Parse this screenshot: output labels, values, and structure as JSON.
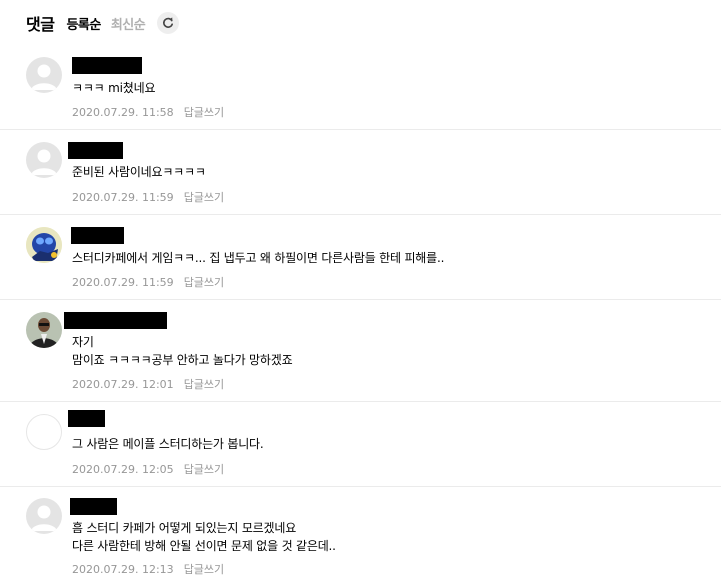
{
  "header": {
    "title": "댓글",
    "sort_registered": "등록순",
    "sort_latest": "최신순",
    "refresh_icon": "refresh-icon"
  },
  "comments": [
    {
      "avatar": "default-avatar",
      "lines": [
        "ㅋㅋㅋ mi쳤네요"
      ],
      "date": "2020.07.29. 11:58",
      "reply": "답글쓰기"
    },
    {
      "avatar": "default-avatar",
      "lines": [
        "준비된 사람이네요ㅋㅋㅋㅋ"
      ],
      "date": "2020.07.29. 11:59",
      "reply": "답글쓰기"
    },
    {
      "avatar": "blue-character-avatar",
      "lines": [
        "스터디카페에서 게임ㅋㅋ... 집 냅두고 왜 하필이면 다른사람들 한테 피해를.."
      ],
      "date": "2020.07.29. 11:59",
      "reply": "답글쓰기"
    },
    {
      "avatar": "photo-avatar",
      "lines": [
        "자기",
        "맘이죠 ㅋㅋㅋㅋ공부 안하고 놀다가 망하겠죠"
      ],
      "date": "2020.07.29. 12:01",
      "reply": "답글쓰기"
    },
    {
      "avatar": "blank-avatar",
      "lines": [
        "그 사람은 메이플 스터디하는가 봅니다."
      ],
      "date": "2020.07.29. 12:05",
      "reply": "답글쓰기"
    },
    {
      "avatar": "default-avatar",
      "lines": [
        "흠 스터디 카페가 어떻게 되있는지 모르겠네요",
        "다른 사람한테 방해 안될 선이면 문제 없을 것 같은데.."
      ],
      "date": "2020.07.29. 12:13",
      "reply": "답글쓰기"
    }
  ]
}
